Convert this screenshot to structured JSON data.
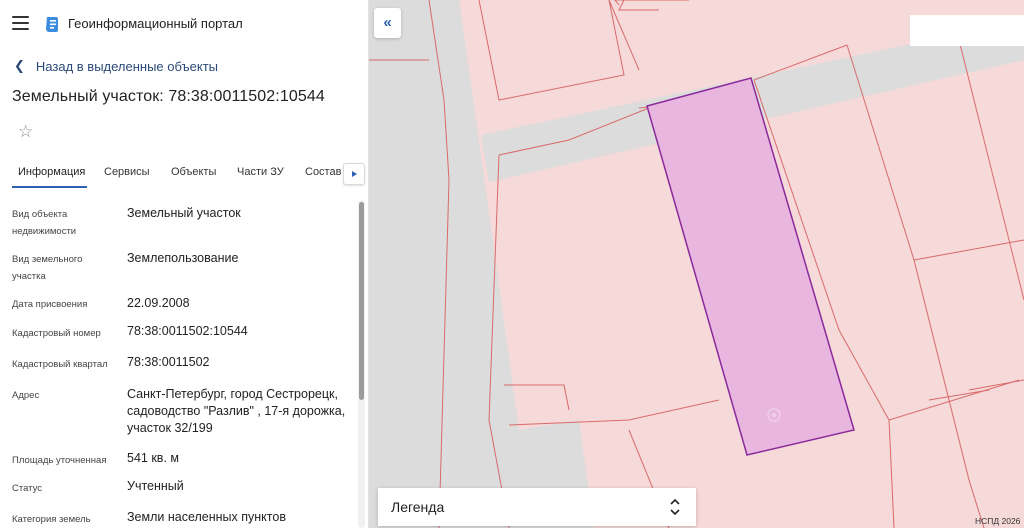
{
  "header": {
    "app_title": "Геоинформационный портал",
    "menu_icon": "menu-icon",
    "logo_icon": "portal-logo-icon"
  },
  "nav": {
    "back_label": "Назад в выделенные объекты"
  },
  "parcel": {
    "title": "Земельный участок: 78:38:0011502:10544"
  },
  "tabs": [
    {
      "label": "Информация",
      "active": true
    },
    {
      "label": "Сервисы"
    },
    {
      "label": "Объекты"
    },
    {
      "label": "Части ЗУ"
    },
    {
      "label": "Состав"
    }
  ],
  "info_rows": [
    {
      "label": "Вид объекта недвижимости",
      "value": "Земельный участок"
    },
    {
      "label": "Вид земельного участка",
      "value": "Землепользование"
    },
    {
      "label": "Дата присвоения",
      "value": "22.09.2008"
    },
    {
      "label": "Кадастровый номер",
      "value": "78:38:0011502:10544"
    },
    {
      "label": "Кадастровый квартал",
      "value": "78:38:0011502"
    },
    {
      "label": "Адрес",
      "value": "Санкт-Петербург, город Сестрорецк, садоводство \"Разлив\" , 17-я дорожка, участок 32/199"
    },
    {
      "label": "Площадь уточненная",
      "value": "541 кв. м"
    },
    {
      "label": "Статус",
      "value": "Учтенный"
    },
    {
      "label": "Категория земель",
      "value": "Земли населенных пунктов"
    }
  ],
  "map": {
    "legend_label": "Легенда",
    "copyright": "НСПД 2026",
    "colors": {
      "parcel_fill": "#f6d9d9",
      "parcel_border": "#d96a6a",
      "road": "#dcdcdc",
      "selected_fill": "#e8b6df",
      "selected_border": "#8a2a9a",
      "accent": "#2b5fb4"
    }
  }
}
